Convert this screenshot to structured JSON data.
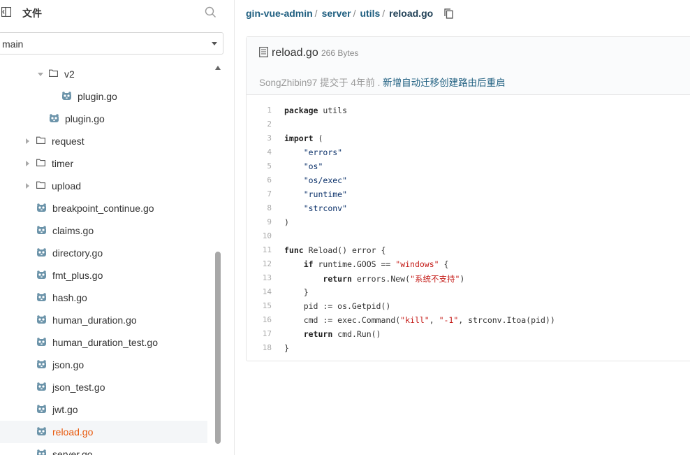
{
  "sidebar": {
    "title": "文件",
    "branch": "main",
    "tree": [
      {
        "label": "v2",
        "type": "folder",
        "state": "expanded",
        "depth": 2
      },
      {
        "label": "plugin.go",
        "type": "file",
        "depth": 3
      },
      {
        "label": "plugin.go",
        "type": "file",
        "depth": 2
      },
      {
        "label": "request",
        "type": "folder",
        "state": "collapsed",
        "depth": 1
      },
      {
        "label": "timer",
        "type": "folder",
        "state": "collapsed",
        "depth": 1
      },
      {
        "label": "upload",
        "type": "folder",
        "state": "collapsed",
        "depth": 1
      },
      {
        "label": "breakpoint_continue.go",
        "type": "file",
        "depth": 1
      },
      {
        "label": "claims.go",
        "type": "file",
        "depth": 1
      },
      {
        "label": "directory.go",
        "type": "file",
        "depth": 1
      },
      {
        "label": "fmt_plus.go",
        "type": "file",
        "depth": 1
      },
      {
        "label": "hash.go",
        "type": "file",
        "depth": 1
      },
      {
        "label": "human_duration.go",
        "type": "file",
        "depth": 1
      },
      {
        "label": "human_duration_test.go",
        "type": "file",
        "depth": 1
      },
      {
        "label": "json.go",
        "type": "file",
        "depth": 1
      },
      {
        "label": "json_test.go",
        "type": "file",
        "depth": 1
      },
      {
        "label": "jwt.go",
        "type": "file",
        "depth": 1
      },
      {
        "label": "reload.go",
        "type": "file",
        "depth": 1,
        "selected": true
      },
      {
        "label": "server.go",
        "type": "file",
        "depth": 1
      }
    ]
  },
  "breadcrumb": [
    "gin-vue-admin",
    "server",
    "utils",
    "reload.go"
  ],
  "file": {
    "name": "reload.go",
    "size": "266 Bytes",
    "commit_author": "SongZhibin97",
    "commit_action": "提交于",
    "commit_time": "4年前",
    "commit_message": "新增自动迁移创建路由后重启"
  },
  "code_lines": [
    "package utils",
    "",
    "import (",
    "    \"errors\"",
    "    \"os\"",
    "    \"os/exec\"",
    "    \"runtime\"",
    "    \"strconv\"",
    ")",
    "",
    "func Reload() error {",
    "    if runtime.GOOS == \"windows\" {",
    "        return errors.New(\"系统不支持\")",
    "    }",
    "    pid := os.Getpid()",
    "    cmd := exec.Command(\"kill\", \"-1\", strconv.Itoa(pid))",
    "    return cmd.Run()",
    "}"
  ],
  "colors": {
    "accent": "#1f5f80",
    "selected": "#e8590c"
  }
}
